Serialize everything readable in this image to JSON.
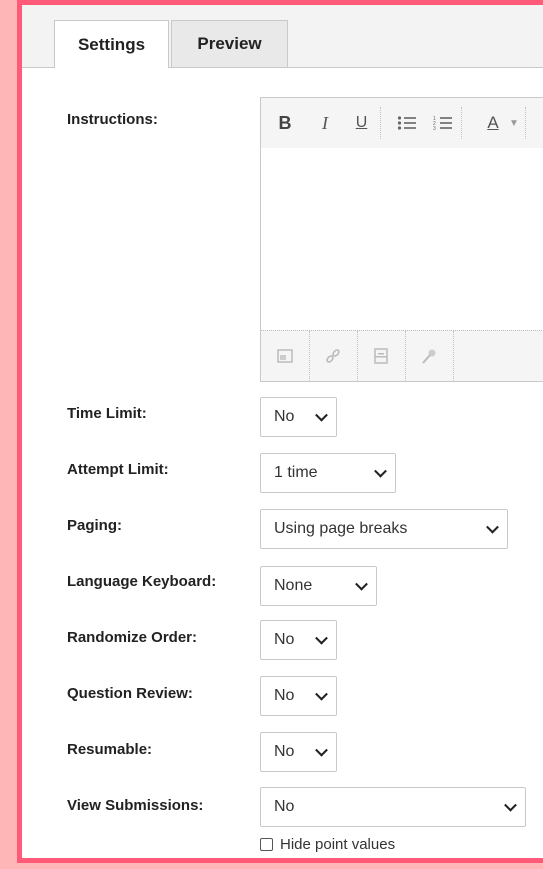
{
  "tabs": [
    {
      "label": "Settings",
      "active": true
    },
    {
      "label": "Preview",
      "active": false
    }
  ],
  "instructions": {
    "label": "Instructions:",
    "toolbar": {
      "bold": "B",
      "italic": "I",
      "underline": "U",
      "font_color": "A"
    },
    "footer_icons": [
      "insert-image-icon",
      "link-icon",
      "archive-icon",
      "microphone-icon"
    ],
    "content": ""
  },
  "fields": [
    {
      "key": "time_limit",
      "label": "Time Limit:",
      "value": "No"
    },
    {
      "key": "attempt_limit",
      "label": "Attempt Limit:",
      "value": "1 time"
    },
    {
      "key": "paging",
      "label": "Paging:",
      "value": "Using page breaks"
    },
    {
      "key": "language_keyboard",
      "label": "Language Keyboard:",
      "value": "None"
    },
    {
      "key": "randomize_order",
      "label": "Randomize Order:",
      "value": "No"
    },
    {
      "key": "question_review",
      "label": "Question Review:",
      "value": "No"
    },
    {
      "key": "resumable",
      "label": "Resumable:",
      "value": "No"
    },
    {
      "key": "view_submissions",
      "label": "View Submissions:",
      "value": "No"
    }
  ],
  "hide_point_values": {
    "label": "Hide point values",
    "checked": false
  },
  "colors": {
    "frame_border": "#ff5b78",
    "page_background": "#ffb6b6"
  }
}
